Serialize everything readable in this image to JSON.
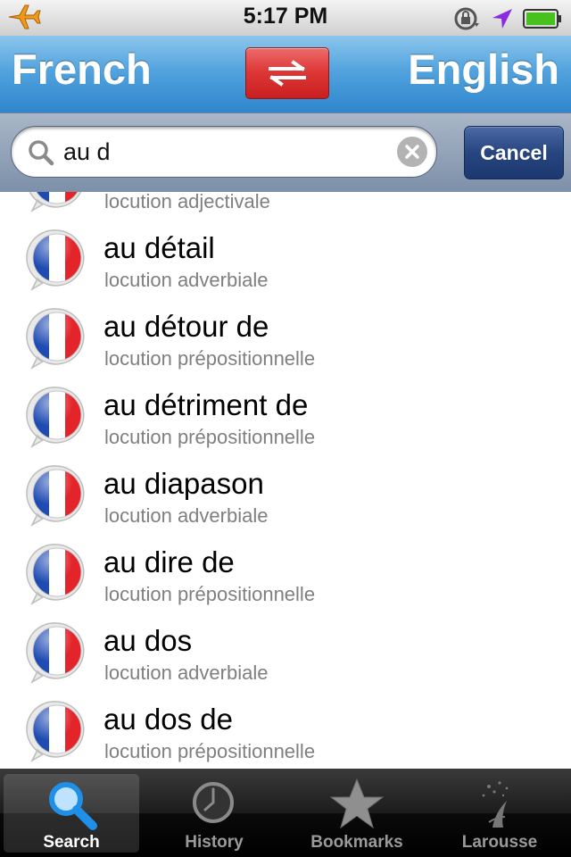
{
  "status_bar": {
    "time": "5:17 PM",
    "icons": [
      "airplane-icon",
      "rotation-lock-icon",
      "location-arrow-icon",
      "battery-icon"
    ],
    "battery_color": "#46c11e"
  },
  "header": {
    "source_language": "French",
    "target_language": "English",
    "swap_icon": "swap-arrows-icon",
    "header_color": "#4a9fdc",
    "swap_button_color": "#d93030"
  },
  "search": {
    "query": "au d",
    "clear_icon": "clear-icon",
    "cancel_label": "Cancel"
  },
  "results": [
    {
      "headword": "",
      "pos": "locution adjectivale"
    },
    {
      "headword": "au détail",
      "pos": "locution adverbiale"
    },
    {
      "headword": "au détour de",
      "pos": "locution prépositionnelle"
    },
    {
      "headword": "au détriment de",
      "pos": "locution prépositionnelle"
    },
    {
      "headword": "au diapason",
      "pos": "locution adverbiale"
    },
    {
      "headword": "au dire de",
      "pos": "locution prépositionnelle"
    },
    {
      "headword": "au dos",
      "pos": "locution adverbiale"
    },
    {
      "headword": "au dos de",
      "pos": "locution prépositionnelle"
    }
  ],
  "tab_bar": {
    "tabs": [
      {
        "label": "Search",
        "icon": "magnifier-icon",
        "active": true
      },
      {
        "label": "History",
        "icon": "clock-icon",
        "active": false
      },
      {
        "label": "Bookmarks",
        "icon": "star-icon",
        "active": false
      },
      {
        "label": "Larousse",
        "icon": "larousse-logo-icon",
        "active": false
      }
    ]
  }
}
